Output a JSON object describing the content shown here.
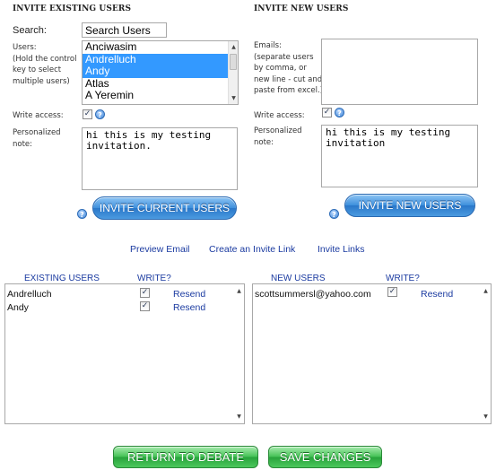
{
  "existing": {
    "header": "INVITE EXISTING USERS",
    "search_label": "Search:",
    "search_value": "Search Users",
    "users_label_lines": [
      "Users:",
      "(Hold the control",
      "key to select",
      "multiple users)"
    ],
    "user_options": [
      {
        "name": "Anciwasim",
        "selected": false
      },
      {
        "name": "Andrelluch",
        "selected": true
      },
      {
        "name": "Andy",
        "selected": true
      },
      {
        "name": "Atlas",
        "selected": false
      },
      {
        "name": "A Yeremin",
        "selected": false
      }
    ],
    "write_access_label": "Write access:",
    "note_label_lines": [
      "Personalized",
      "note:"
    ],
    "note_value": "hi this is my testing invitation.",
    "invite_button": "INVITE CURRENT USERS"
  },
  "new": {
    "header": "INVITE NEW USERS",
    "emails_label_lines": [
      "Emails:",
      "(separate users",
      "by comma, or",
      "new line - cut and",
      "paste from excel.)"
    ],
    "emails_value": "",
    "write_access_label": "Write access:",
    "note_label_lines": [
      "Personalized",
      "note:"
    ],
    "note_value": "hi this is my testing invitation",
    "invite_button": "INVITE NEW USERS"
  },
  "links": {
    "preview": "Preview Email",
    "create": "Create an Invite Link",
    "invite_links": "Invite Links"
  },
  "existing_table": {
    "col_users": "EXISTING USERS",
    "col_write": "WRITE?",
    "rows": [
      {
        "name": "Andrelluch",
        "write": true,
        "action": "Resend"
      },
      {
        "name": "Andy",
        "write": true,
        "action": "Resend"
      }
    ]
  },
  "new_table": {
    "col_users": "NEW USERS",
    "col_write": "WRITE?",
    "rows": [
      {
        "name": "scottsummersl@yahoo.com",
        "write": true,
        "action": "Resend"
      }
    ]
  },
  "footer": {
    "return_button": "RETURN TO DEBATE",
    "save_button": "SAVE CHANGES"
  },
  "icons": {
    "help": "?",
    "check": "✓",
    "scroll_up": "▲",
    "scroll_down": "▼"
  }
}
